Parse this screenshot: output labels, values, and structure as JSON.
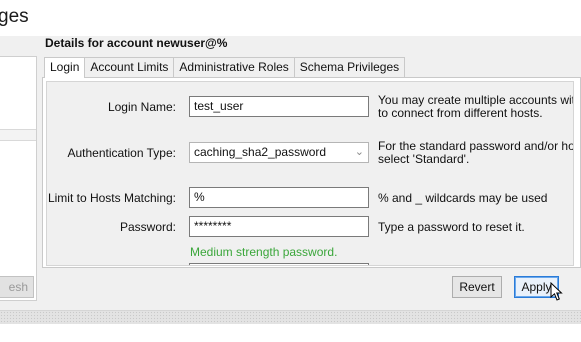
{
  "page": {
    "heading": "ges"
  },
  "details": {
    "title": "Details for account newuser@%",
    "tabs": [
      {
        "label": "Login",
        "active": true
      },
      {
        "label": "Account Limits",
        "active": false
      },
      {
        "label": "Administrative Roles",
        "active": false
      },
      {
        "label": "Schema Privileges",
        "active": false
      }
    ]
  },
  "form": {
    "login_name": {
      "label": "Login Name:",
      "value": "test_user",
      "help1": "You may create multiple accounts with t",
      "help2": "to connect from different hosts."
    },
    "auth_type": {
      "label": "Authentication Type:",
      "value": "caching_sha2_password",
      "help1": "For the standard password and/or host",
      "help2": "select 'Standard'."
    },
    "hosts": {
      "label": "Limit to Hosts Matching:",
      "value": "%",
      "help": "% and _ wildcards may be used"
    },
    "password": {
      "label": "Password:",
      "value": "********",
      "help": "Type a password to reset it.",
      "strength": "Medium strength password."
    }
  },
  "buttons": {
    "refresh": "esh",
    "revert": "Revert",
    "apply": "Apply"
  },
  "colors": {
    "strength_text": "#3aa63a",
    "apply_border": "#2a7bd8"
  }
}
